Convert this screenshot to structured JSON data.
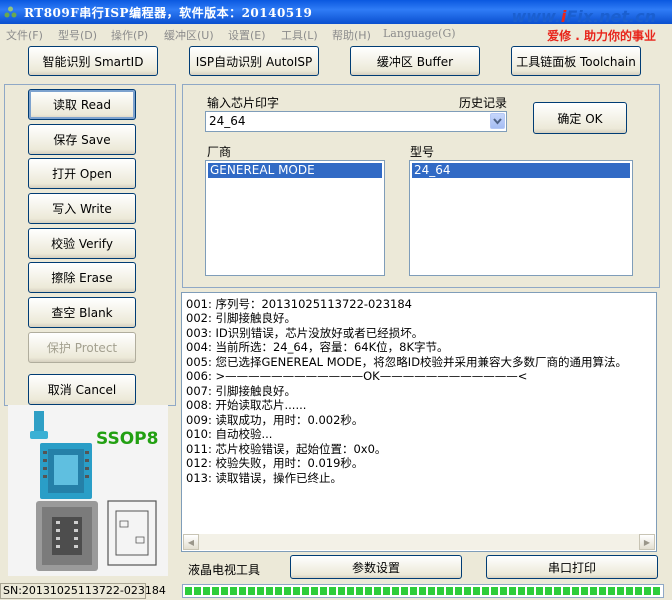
{
  "title": "RT809F串行ISP编程器，软件版本：20140519",
  "watermark": {
    "site_prefix": "www.",
    "site_highlight": "i",
    "site_suffix": "Fix.net.cn",
    "slogan": "爱修 . 助力你的事业"
  },
  "menu": [
    "文件(F)",
    "型号(D)",
    "操作(P)",
    "缓冲区(U)",
    "设置(E)",
    "工具(L)",
    "帮助(H)",
    "Language(G)"
  ],
  "toolbar": {
    "smartid": "智能识别 SmartID",
    "autoisp": "ISP自动识别 AutoISP",
    "buffer": "缓冲区 Buffer",
    "toolchain": "工具链面板 Toolchain"
  },
  "actions": {
    "read": "读取 Read",
    "save": "保存 Save",
    "open": "打开 Open",
    "write": "写入 Write",
    "verify": "校验 Verify",
    "erase": "擦除 Erase",
    "blank": "查空 Blank",
    "protect": "保护 Protect",
    "cancel": "取消 Cancel"
  },
  "chip": {
    "input_label": "输入芯片印字",
    "history_label": "历史记录",
    "input_value": "24_64",
    "ok_button": "确定 OK",
    "vendor_label": "厂商",
    "vendor_selected": "GENEREAL MODE",
    "model_label": "型号",
    "model_selected": "24_64"
  },
  "log": [
    "001: 序列号：20131025113722-023184",
    "002: 引脚接触良好。",
    "003: ID识别错误，芯片没放好或者已经损坏。",
    "004: 当前所选：24_64，容量：64K位，8K字节。",
    "005: 您已选择GENEREAL MODE，将忽略ID校验并采用兼容大多数厂商的通用算法。",
    "006: >————————————OK————————————<",
    "007: 引脚接触良好。",
    "008: 开始读取芯片......",
    "009: 读取成功，用时：0.002秒。",
    "010: 自动校验...",
    "011: 芯片校验错误，起始位置：0x0。",
    "012: 校验失败，用时：0.019秒。",
    "013: 读取错误，操作已终止。"
  ],
  "bottom": {
    "lcd_label": "液晶电视工具",
    "params_button": "参数设置",
    "serial_print_button": "串口打印"
  },
  "photo": {
    "package_label": "SSOP8"
  },
  "status": {
    "sn": "SN:20131025113722-023184",
    "progress": 1.0
  },
  "colors": {
    "title_bar": "#0a58e0",
    "selection": "#316ac5",
    "progress": "#2dcd3a",
    "package_label": "#22a012"
  }
}
